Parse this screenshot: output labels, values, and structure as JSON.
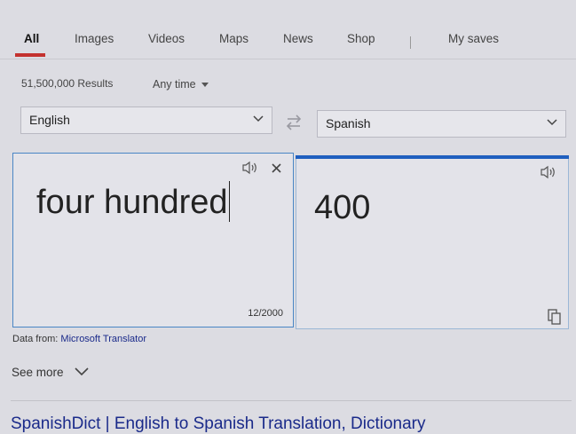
{
  "nav": {
    "all": "All",
    "images": "Images",
    "videos": "Videos",
    "maps": "Maps",
    "news": "News",
    "shop": "Shop",
    "my_saves": "My saves"
  },
  "meta": {
    "results": "51,500,000 Results",
    "any_time": "Any time"
  },
  "translator": {
    "source_language": "English",
    "target_language": "Spanish",
    "source_text": "four hundred",
    "translated_text": "400",
    "char_count": "12/2000"
  },
  "footer": {
    "data_from": "Data from:",
    "provider": "Microsoft Translator",
    "see_more": "See more",
    "next_result_title": "SpanishDict | English to Spanish Translation, Dictionary"
  },
  "colors": {
    "accent_red": "#c4322f",
    "accent_blue": "#1f5fbf",
    "link": "#1a2a8a"
  },
  "icons": [
    "speaker-icon",
    "close-icon",
    "swap-languages-icon",
    "chevron-down-icon",
    "copy-icon"
  ]
}
